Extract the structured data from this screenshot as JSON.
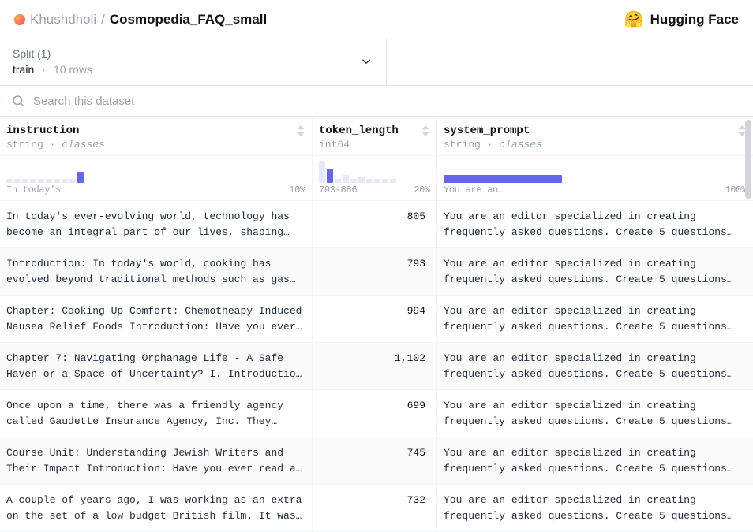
{
  "header": {
    "owner": "Khushdholi",
    "sep": "/",
    "dataset": "Cosmopedia_FAQ_small",
    "brand": "Hugging Face",
    "brand_emoji": "🤗"
  },
  "split": {
    "label": "Split (1)",
    "name": "train",
    "rows": "10 rows"
  },
  "search": {
    "placeholder": "Search this dataset"
  },
  "columns": {
    "c0": {
      "name": "instruction",
      "type": "string",
      "classes": "classes"
    },
    "c1": {
      "name": "token_length",
      "type": "int64"
    },
    "c2": {
      "name": "system_prompt",
      "type": "string",
      "classes": "classes"
    }
  },
  "hist": {
    "c0": {
      "left": "In today's…",
      "right": "10%"
    },
    "c1": {
      "left": "793-886",
      "right": "20%"
    },
    "c2": {
      "left": "You are an…",
      "right": "100%"
    }
  },
  "rows": [
    {
      "instruction": "In today's ever-evolving world, technology has become an integral part of our lives, shaping…",
      "token_length": "805",
      "system_prompt": "You are an editor specialized in creating frequently asked questions. Create 5 questions…"
    },
    {
      "instruction": "Introduction: In today's world, cooking has evolved beyond traditional methods such as gas…",
      "token_length": "793",
      "system_prompt": "You are an editor specialized in creating frequently asked questions. Create 5 questions…"
    },
    {
      "instruction": "Chapter: Cooking Up Comfort: Chemotheapy-Induced Nausea Relief Foods Introduction: Have you ever…",
      "token_length": "994",
      "system_prompt": "You are an editor specialized in creating frequently asked questions. Create 5 questions…"
    },
    {
      "instruction": "Chapter 7: Navigating Orphanage Life - A Safe Haven or a Space of Uncertainty? I. Introductio…",
      "token_length": "1,102",
      "system_prompt": "You are an editor specialized in creating frequently asked questions. Create 5 questions…"
    },
    {
      "instruction": "Once upon a time, there was a friendly agency called Gaudette Insurance Agency, Inc. They…",
      "token_length": "699",
      "system_prompt": "You are an editor specialized in creating frequently asked questions. Create 5 questions…"
    },
    {
      "instruction": "Course Unit: Understanding Jewish Writers and Their Impact Introduction: Have you ever read a…",
      "token_length": "745",
      "system_prompt": "You are an editor specialized in creating frequently asked questions. Create 5 questions…"
    },
    {
      "instruction": "A couple of years ago, I was working as an extra on the set of a low budget British film. It was…",
      "token_length": "732",
      "system_prompt": "You are an editor specialized in creating frequently asked questions. Create 5 questions…"
    }
  ]
}
